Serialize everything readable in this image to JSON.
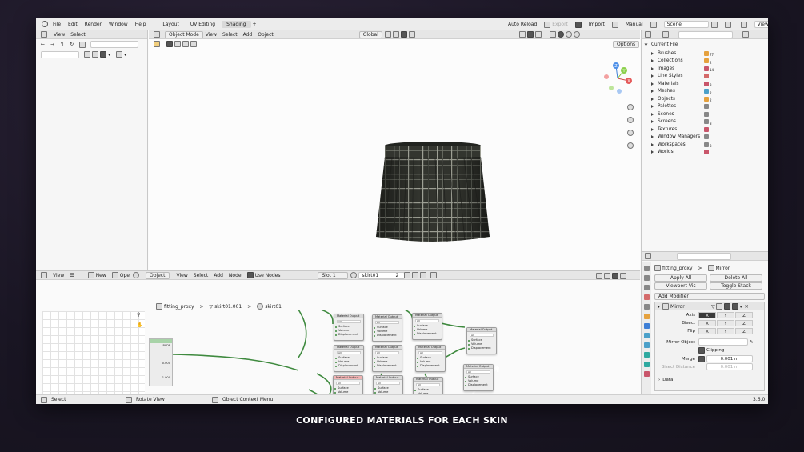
{
  "menu": {
    "items": [
      "File",
      "Edit",
      "Render",
      "Window",
      "Help"
    ],
    "tabs": [
      "Layout",
      "UV Editing",
      "Shading"
    ],
    "active_tab": "Shading",
    "add_tab": "+",
    "auto_reload": "Auto Reload",
    "export": "Export",
    "import": "Import",
    "manual": "Manual",
    "scene": "Scene",
    "view_layer": "ViewLayer"
  },
  "left_panel": {
    "view": "View",
    "select": "Select"
  },
  "viewport": {
    "mode": "Object Mode",
    "menus": [
      "View",
      "Select",
      "Add",
      "Object"
    ],
    "orientation": "Global",
    "options": "Options",
    "gizmo": {
      "x": "X",
      "y": "Y",
      "z": "Z"
    }
  },
  "outliner": {
    "root": "Current File",
    "items": [
      {
        "label": "Brushes",
        "count": "77"
      },
      {
        "label": "Collections",
        "count": "2"
      },
      {
        "label": "Images",
        "count": "14"
      },
      {
        "label": "Line Styles",
        "count": ""
      },
      {
        "label": "Materials",
        "count": "3"
      },
      {
        "label": "Meshes",
        "count": "2"
      },
      {
        "label": "Objects",
        "count": "2"
      },
      {
        "label": "Palettes",
        "count": ""
      },
      {
        "label": "Scenes",
        "count": ""
      },
      {
        "label": "Screens",
        "count": "3"
      },
      {
        "label": "Textures",
        "count": ""
      },
      {
        "label": "Window Managers",
        "count": ""
      },
      {
        "label": "Workspaces",
        "count": "3"
      },
      {
        "label": "Worlds",
        "count": ""
      }
    ]
  },
  "node_editor": {
    "view": "View",
    "new": "New",
    "open": "Ope",
    "object": "Object",
    "menus": [
      "View",
      "Select",
      "Add",
      "Node"
    ],
    "use_nodes": "Use Nodes",
    "slot": "Slot 1",
    "material": "skirt01",
    "users": "2",
    "breadcrumb": [
      "fitting_proxy",
      "skirt01.001",
      "skirt01"
    ],
    "node_title": "Material Output",
    "node_target": "All",
    "sockets": [
      "Surface",
      "Volume",
      "Displacement"
    ],
    "frame_values": [
      "0.000",
      "1.000"
    ],
    "frame_label": "BSDF"
  },
  "properties": {
    "object": "fitting_proxy",
    "modifier_name_header": "Mirror",
    "apply_all": "Apply All",
    "delete_all": "Delete All",
    "viewport_vis": "Viewport Vis",
    "toggle_stack": "Toggle Stack",
    "add_modifier": "Add Modifier",
    "modifier": "Mirror",
    "axis_label": "Axis",
    "bisect_label": "Bisect",
    "flip_label": "Flip",
    "axes": [
      "X",
      "Y",
      "Z"
    ],
    "mirror_object": "Mirror Object",
    "clipping": "Clipping",
    "merge": "Merge",
    "merge_value": "0.001 m",
    "bisect_distance": "Bisect Distance",
    "bisect_distance_value": "0.001 m",
    "data": "Data"
  },
  "status": {
    "select": "Select",
    "rotate": "Rotate View",
    "context": "Object Context Menu",
    "version": "3.6.0"
  },
  "caption": "CONFIGURED MATERIALS FOR EACH SKIN",
  "colors": {
    "background": "#1a1624",
    "link_green": "#3f8a3f",
    "accent_blue": "#3e7fd6",
    "node_selected": "#f0b3b3"
  }
}
